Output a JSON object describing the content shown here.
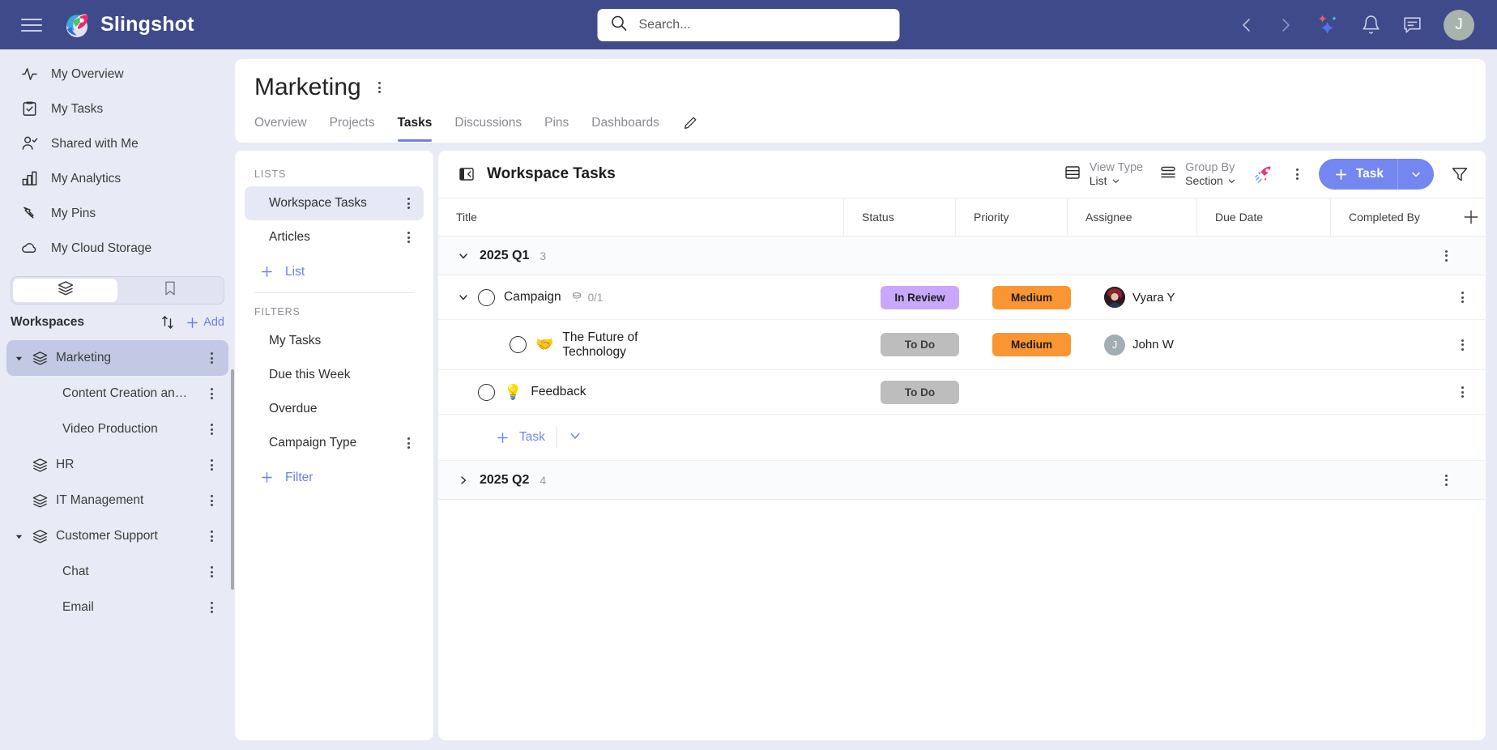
{
  "topbar": {
    "brand": "Slingshot",
    "menu_icon": "hamburger-icon",
    "search": {
      "placeholder": "Search...",
      "value": "",
      "icon": "search-icon"
    },
    "icons": [
      "chevron-left-icon",
      "chevron-right-icon",
      "ai-sparkle-icon",
      "bell-icon",
      "chat-icon"
    ],
    "avatar_initial": "J",
    "bg_color": "#3f4a8a"
  },
  "sidebar": {
    "nav": [
      {
        "label": "My Overview",
        "icon": "pulse-icon"
      },
      {
        "label": "My Tasks",
        "icon": "clipboard-check-icon"
      },
      {
        "label": "Shared with Me",
        "icon": "person-check-icon"
      },
      {
        "label": "My Analytics",
        "icon": "bar-chart-icon"
      },
      {
        "label": "My Pins",
        "icon": "pin-icon"
      },
      {
        "label": "My Cloud Storage",
        "icon": "cloud-icon"
      }
    ],
    "segments": [
      {
        "icon": "layers-icon",
        "active": true
      },
      {
        "icon": "bookmark-icon",
        "active": false
      }
    ],
    "workspaces_title": "Workspaces",
    "sort_icon": "sort-arrows-icon",
    "add_label": "Add",
    "workspaces": [
      {
        "label": "Marketing",
        "icon": "layers-icon",
        "expandable": true,
        "expanded": true,
        "selected": true,
        "child": false
      },
      {
        "label": "Content Creation an…",
        "expandable": false,
        "selected": false,
        "child": true
      },
      {
        "label": "Video Production",
        "expandable": false,
        "selected": false,
        "child": true
      },
      {
        "label": "HR",
        "icon": "layers-icon",
        "expandable": false,
        "selected": false,
        "child": false
      },
      {
        "label": "IT Management",
        "icon": "layers-icon",
        "expandable": false,
        "selected": false,
        "child": false
      },
      {
        "label": "Customer Support",
        "icon": "layers-icon",
        "expandable": true,
        "expanded": true,
        "selected": false,
        "child": false
      },
      {
        "label": "Chat",
        "expandable": false,
        "selected": false,
        "child": true
      },
      {
        "label": "Email",
        "expandable": false,
        "selected": false,
        "child": true
      }
    ]
  },
  "page": {
    "title": "Marketing",
    "title_menu_icon": "kebab-icon",
    "tabs": [
      {
        "label": "Overview",
        "active": false
      },
      {
        "label": "Projects",
        "active": false
      },
      {
        "label": "Tasks",
        "active": true
      },
      {
        "label": "Discussions",
        "active": false
      },
      {
        "label": "Pins",
        "active": false
      },
      {
        "label": "Dashboards",
        "active": false
      }
    ],
    "edit_icon": "pencil-icon"
  },
  "lists_panel": {
    "lists_label": "LISTS",
    "lists": [
      {
        "label": "Workspace Tasks",
        "selected": true
      },
      {
        "label": "Articles",
        "selected": false
      }
    ],
    "add_list_label": "List",
    "filters_label": "FILTERS",
    "filters": [
      {
        "label": "My Tasks",
        "has_menu": false
      },
      {
        "label": "Due this Week",
        "has_menu": false
      },
      {
        "label": "Overdue",
        "has_menu": false
      },
      {
        "label": "Campaign Type",
        "has_menu": true
      }
    ],
    "add_filter_label": "Filter"
  },
  "tasks_panel": {
    "collapse_icon": "collapse-panel-icon",
    "heading": "Workspace Tasks",
    "view_type": {
      "label": "View Type",
      "value": "List",
      "icon": "list-view-icon"
    },
    "group_by": {
      "label": "Group By",
      "value": "Section",
      "icon": "group-icon"
    },
    "rocket_icon": "rocket-icon",
    "more_icon": "kebab-icon",
    "task_button": {
      "label": "Task",
      "plus_icon": "plus-icon",
      "caret_icon": "chevron-down-icon"
    },
    "filter_icon": "funnel-icon",
    "columns": [
      "Title",
      "Status",
      "Priority",
      "Assignee",
      "Due Date",
      "Completed By"
    ],
    "add_column_icon": "plus-icon",
    "groups": [
      {
        "name": "2025 Q1",
        "count": "3",
        "expanded": true,
        "tasks": [
          {
            "name": "Campaign",
            "emoji": "",
            "subtasks": "0/1",
            "has_caret": true,
            "indent": 0,
            "status": {
              "label": "In Review",
              "color": "#c9a7fb"
            },
            "priority": {
              "label": "Medium",
              "color": "#f99633"
            },
            "assignee": {
              "name": "Vyara Y",
              "type": "photo"
            },
            "due_date": "",
            "completed_by": ""
          },
          {
            "name": "The Future of Technology",
            "emoji": "🤝",
            "subtasks": "",
            "has_caret": false,
            "indent": 1,
            "status": {
              "label": "To Do",
              "color": "#bdbdbd"
            },
            "priority": {
              "label": "Medium",
              "color": "#f99633"
            },
            "assignee": {
              "name": "John W",
              "type": "initial",
              "initial": "J"
            },
            "due_date": "",
            "completed_by": ""
          },
          {
            "name": "Feedback",
            "emoji": "💡",
            "subtasks": "",
            "has_caret": false,
            "indent": 0,
            "status": {
              "label": "To Do",
              "color": "#bdbdbd"
            },
            "priority": null,
            "assignee": null,
            "due_date": "",
            "completed_by": ""
          }
        ],
        "add_task_label": "Task"
      },
      {
        "name": "2025 Q2",
        "count": "4",
        "expanded": false,
        "tasks": []
      }
    ]
  },
  "colors": {
    "accent": "#6d7ff0",
    "header_bg": "#3f4a8a",
    "page_bg": "#e8ebf5",
    "status_review": "#c9a7fb",
    "status_todo": "#bdbdbd",
    "priority_medium": "#f99633",
    "rocket": "#e8367f"
  }
}
